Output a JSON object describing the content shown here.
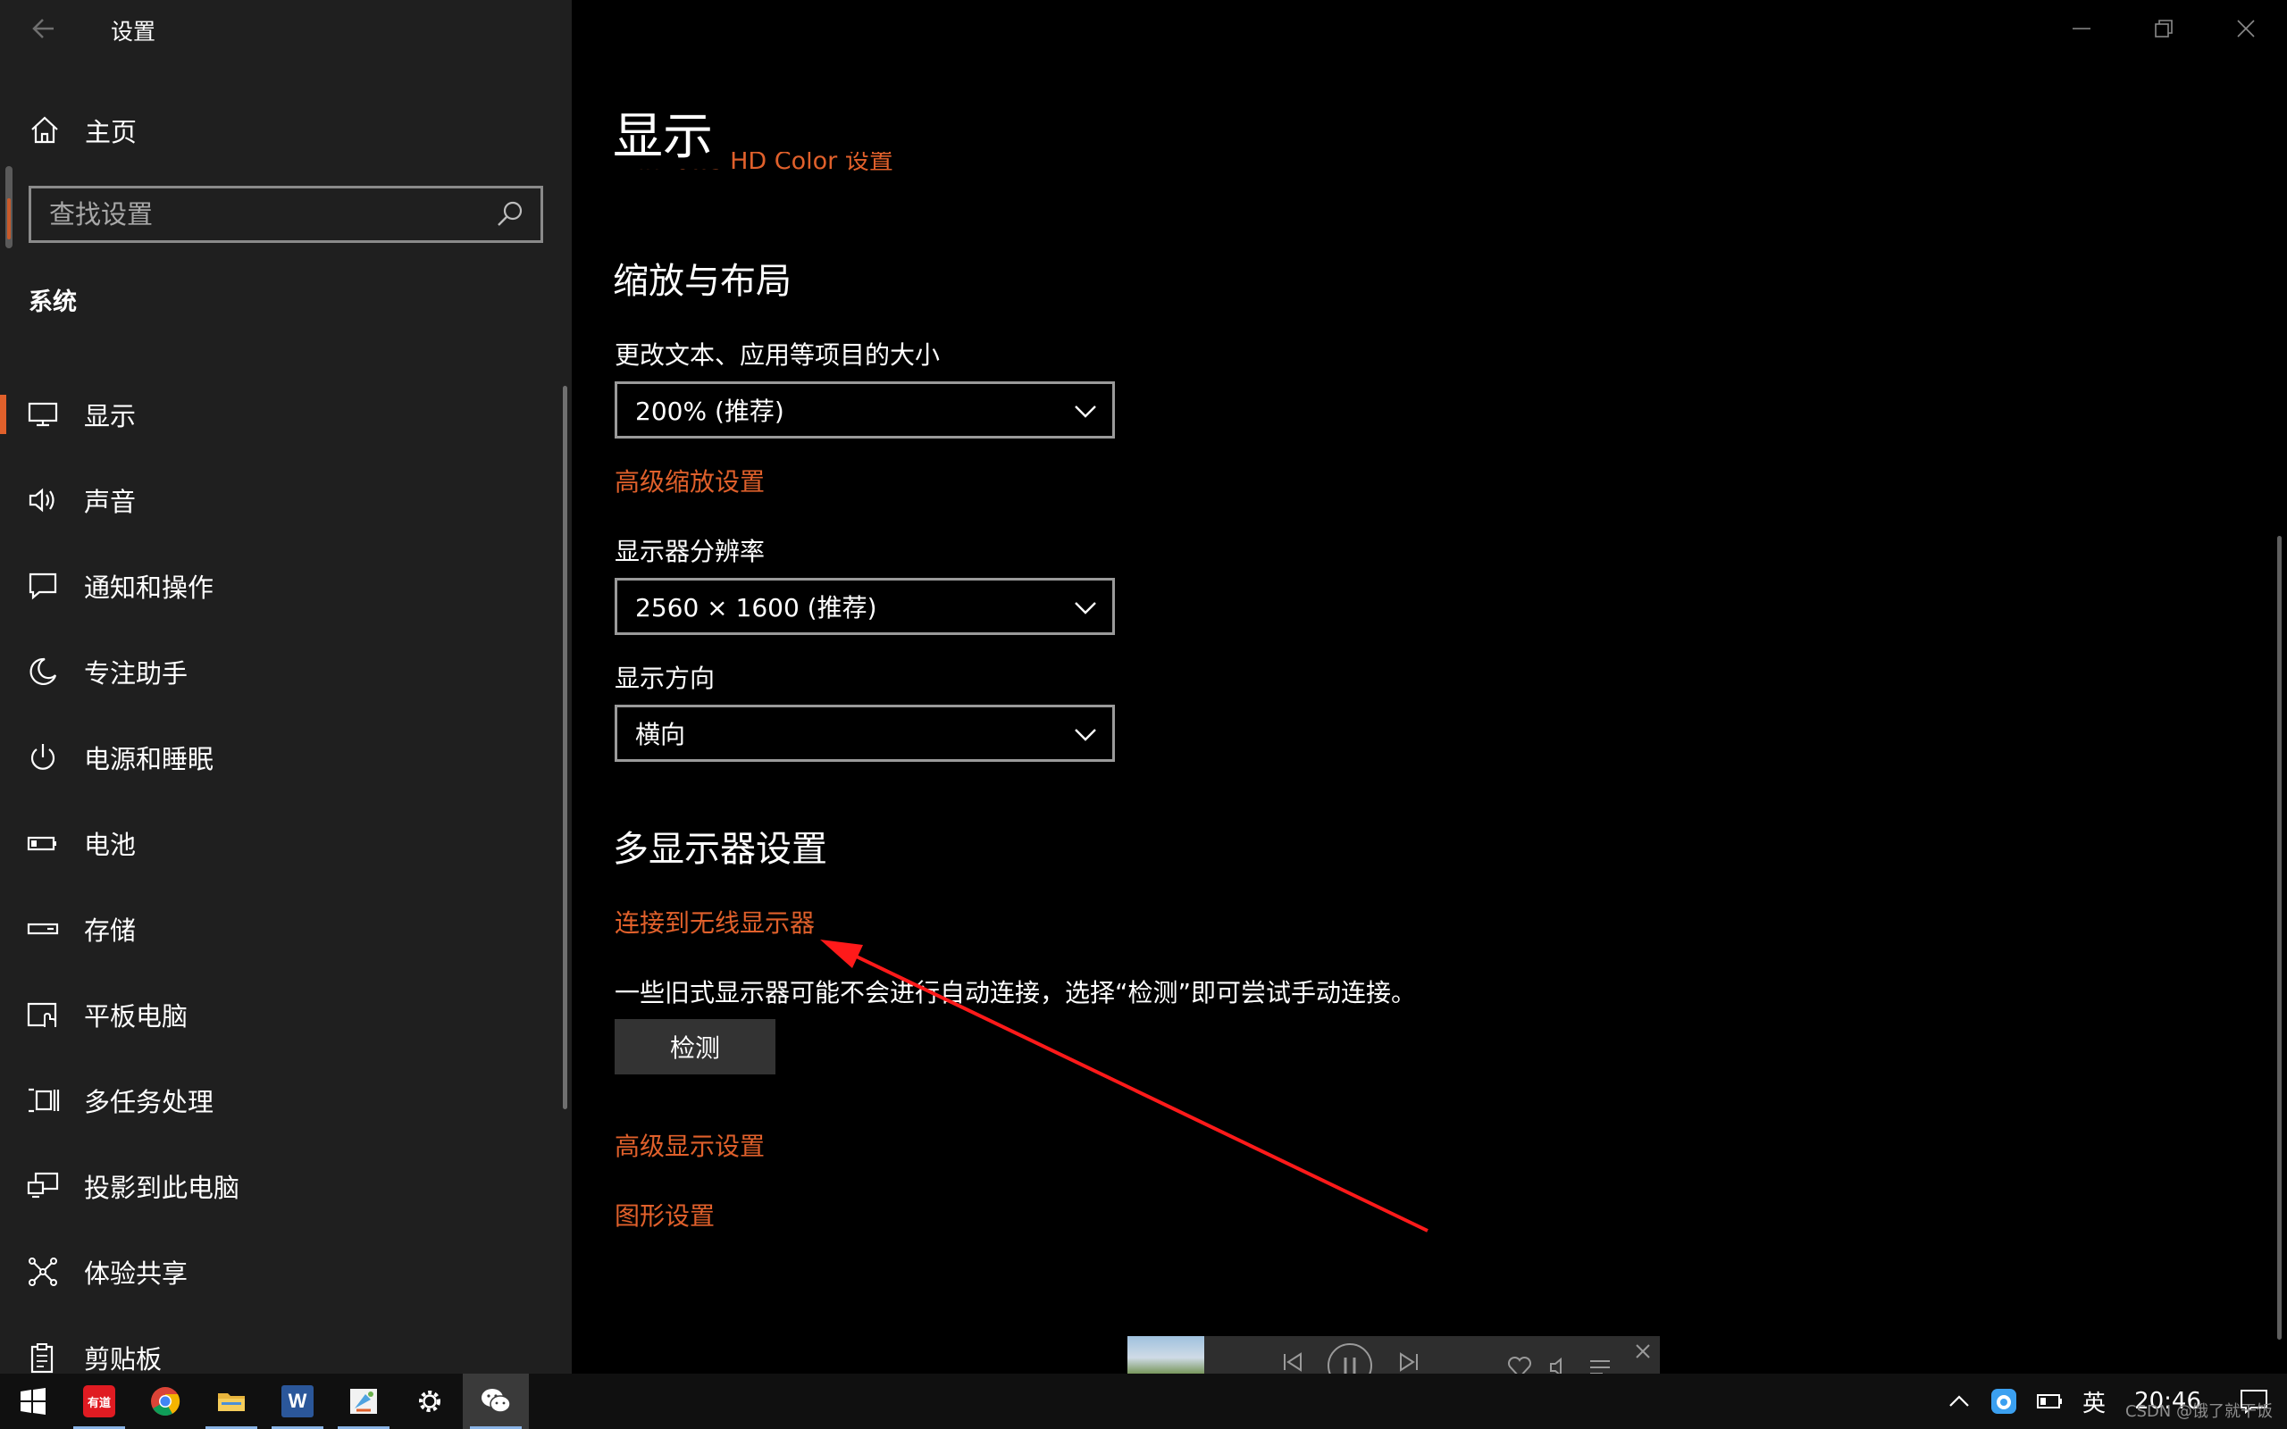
{
  "window": {
    "title": "设置"
  },
  "sidebar": {
    "home_label": "主页",
    "search_placeholder": "查找设置",
    "section": "系统",
    "items": [
      {
        "label": "显示",
        "icon": "monitor-icon",
        "active": true
      },
      {
        "label": "声音",
        "icon": "speaker-icon"
      },
      {
        "label": "通知和操作",
        "icon": "notification-icon"
      },
      {
        "label": "专注助手",
        "icon": "moon-icon"
      },
      {
        "label": "电源和睡眠",
        "icon": "power-icon"
      },
      {
        "label": "电池",
        "icon": "battery-icon"
      },
      {
        "label": "存储",
        "icon": "storage-icon"
      },
      {
        "label": "平板电脑",
        "icon": "tablet-icon"
      },
      {
        "label": "多任务处理",
        "icon": "multitask-icon"
      },
      {
        "label": "投影到此电脑",
        "icon": "project-icon"
      },
      {
        "label": "体验共享",
        "icon": "share-icon"
      },
      {
        "label": "剪贴板",
        "icon": "clipboard-icon"
      }
    ]
  },
  "main": {
    "page_title": "显示",
    "partial_link": "Windows HD Color 设置",
    "scale_section": "缩放与布局",
    "scale_label": "更改文本、应用等项目的大小",
    "scale_value": "200% (推荐)",
    "advanced_scaling_link": "高级缩放设置",
    "resolution_label": "显示器分辨率",
    "resolution_value": "2560 × 1600 (推荐)",
    "orientation_label": "显示方向",
    "orientation_value": "横向",
    "multi_section": "多显示器设置",
    "wireless_link": "连接到无线显示器",
    "detect_hint": "一些旧式显示器可能不会进行自动连接，选择“检测”即可尝试手动连接。",
    "detect_button": "检测",
    "advanced_display_link": "高级显示设置",
    "graphics_link": "图形设置"
  },
  "taskbar": {
    "apps": [
      {
        "name": "start-button",
        "icon": "windows-icon"
      },
      {
        "name": "youdao-app",
        "icon": "youdao-icon",
        "text": "有道"
      },
      {
        "name": "chrome-app",
        "icon": "chrome-icon"
      },
      {
        "name": "explorer-app",
        "icon": "folder-icon"
      },
      {
        "name": "word-app",
        "icon": "word-icon",
        "text": "W"
      },
      {
        "name": "paint-app",
        "icon": "paint-icon"
      },
      {
        "name": "settings-app",
        "icon": "gear-icon"
      },
      {
        "name": "wechat-app",
        "icon": "wechat-icon"
      }
    ],
    "tray": {
      "ime": "英",
      "time": "20:46"
    }
  },
  "watermark": "CSDN @饿了就干饭",
  "colors": {
    "accent": "#e0602b",
    "sidebar_bg": "#1f1f1f",
    "main_bg": "#000000",
    "annotation_arrow": "#ff1a1a"
  }
}
